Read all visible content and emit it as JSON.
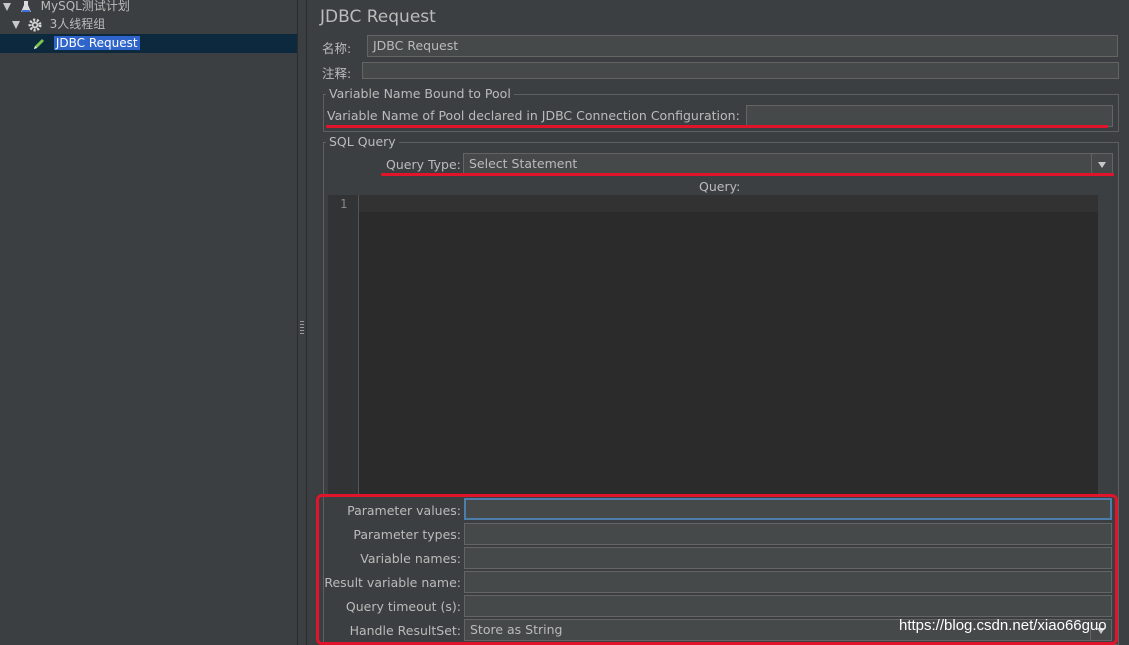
{
  "tree": {
    "items": [
      {
        "label": "MySQL测试计划",
        "icon": "test-plan-icon"
      },
      {
        "label": "3人线程组",
        "icon": "gear-icon"
      },
      {
        "label": "JDBC Request",
        "icon": "pencil-icon"
      }
    ]
  },
  "panel": {
    "title": "JDBC Request",
    "name_label": "名称:",
    "name_value": "JDBC Request",
    "comment_label": "注释:",
    "comment_value": ""
  },
  "pool_group": {
    "title": "Variable Name Bound to Pool",
    "label": "Variable Name of Pool declared in JDBC Connection Configuration:",
    "value": ""
  },
  "sql_group": {
    "title": "SQL Query",
    "query_type_label": "Query Type:",
    "query_type_value": "Select Statement",
    "query_label": "Query:",
    "line_number": "1",
    "query_text": ""
  },
  "params": {
    "parameter_values_label": "Parameter values:",
    "parameter_values": "",
    "parameter_types_label": "Parameter types:",
    "parameter_types": "",
    "variable_names_label": "Variable names:",
    "variable_names": "",
    "result_variable_name_label": "Result variable name:",
    "result_variable_name": "",
    "query_timeout_label": "Query timeout (s):",
    "query_timeout": "",
    "handle_resultset_label": "Handle ResultSet:",
    "handle_resultset_value": "Store as String"
  },
  "watermark": "https://blog.csdn.net/xiao66guo",
  "colors": {
    "background": "#3c3f41",
    "selection": "#2f65ca",
    "annotation_red": "#e0142a"
  }
}
